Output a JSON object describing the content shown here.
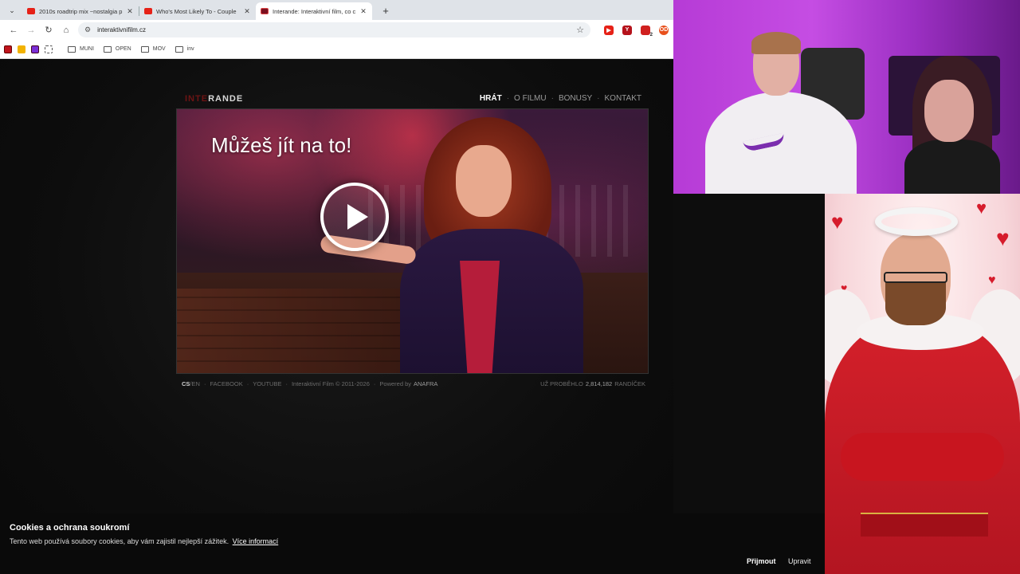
{
  "browser": {
    "tabs": [
      {
        "title": "2010s roadtrip mix ~nostalgia p",
        "favicon": "youtube-icon",
        "active": false
      },
      {
        "title": "Who's Most Likely To - Couple",
        "favicon": "youtube-icon",
        "active": false
      },
      {
        "title": "Interande: Interaktivní film, co c",
        "favicon": "interande-icon",
        "active": true
      }
    ],
    "url": "interaktivnifilm.cz",
    "bookmarks": [
      "MUNI",
      "OPEN",
      "MOV",
      "inv"
    ],
    "ext_labels": {
      "y": "Y",
      "od": "OD",
      "badge": "2"
    }
  },
  "site": {
    "logo_a": "INTE",
    "logo_b": "RANDE",
    "nav": [
      "HRÁT",
      "O FILMU",
      "BONUSY",
      "KONTAKT"
    ],
    "headline": "Můžeš jít na to!",
    "footer": {
      "lang_active": "CS",
      "lang_other": "/EN",
      "facebook": "FACEBOOK",
      "youtube": "YOUTUBE",
      "copyright": "Interaktivní Film © 2011-2026",
      "powered": "Powered by",
      "anafra": "ANAFRA",
      "counter_prefix": "UŽ PROBĚHLO",
      "counter_value": "2,814,182",
      "counter_suffix": "RANDÍČEK"
    }
  },
  "cookie": {
    "title": "Cookies a ochrana soukromí",
    "text": "Tento web používá soubory cookies, aby vám zajistil nejlepší zážitek.",
    "link": "Více informací",
    "accept": "Přijmout",
    "edit": "Upravit"
  },
  "colors": {
    "accent": "#8b1a1a",
    "youtube": "#e62117",
    "page_bg": "#0d0d0d"
  }
}
